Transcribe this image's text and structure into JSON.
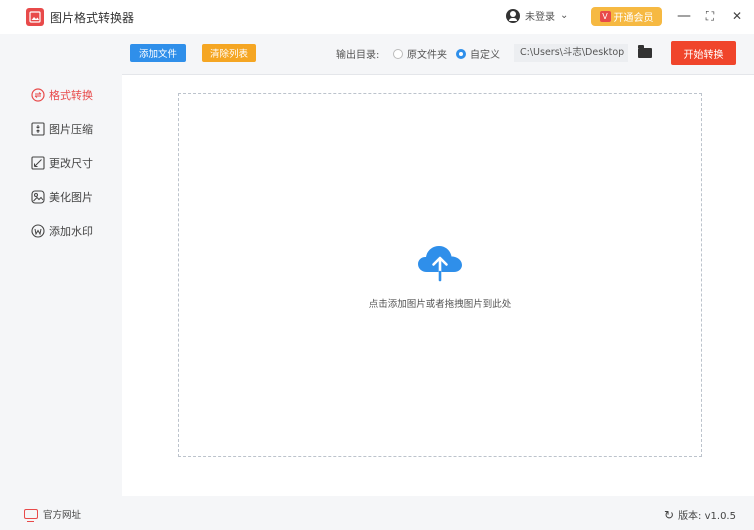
{
  "app": {
    "title": "图片格式转换器"
  },
  "titlebar": {
    "user_label": "未登录",
    "user_chevron": "⌄",
    "vip_badge": "V",
    "vip_label": "开通会员",
    "minimize": "—",
    "maximize": "⛶",
    "close": "✕"
  },
  "sidebar": {
    "items": [
      {
        "label": "格式转换",
        "icon": "format-convert-icon",
        "active": true
      },
      {
        "label": "图片压缩",
        "icon": "compress-icon",
        "active": false
      },
      {
        "label": "更改尺寸",
        "icon": "resize-icon",
        "active": false
      },
      {
        "label": "美化图片",
        "icon": "beautify-icon",
        "active": false
      },
      {
        "label": "添加水印",
        "icon": "watermark-icon",
        "active": false
      }
    ]
  },
  "toolbar": {
    "add_file_label": "添加文件",
    "clear_list_label": "清除列表",
    "output_dir_label": "输出目录:",
    "radio_original_label": "原文件夹",
    "radio_custom_label": "自定义",
    "selected_radio": "自定义",
    "path_value": "C:\\Users\\斗志\\Desktop",
    "start_label": "开始转换"
  },
  "dropzone": {
    "hint": "点击添加图片或者拖拽图片到此处",
    "icon": "cloud-upload-icon"
  },
  "footer": {
    "site_label": "官方网址",
    "version_label": "版本: v1.0.5"
  },
  "colors": {
    "accent_red": "#e84a4a",
    "primary_blue": "#2f8fea",
    "clear_orange": "#f5a623",
    "start_red": "#f0452b",
    "vip_gold": "#f6b942"
  }
}
